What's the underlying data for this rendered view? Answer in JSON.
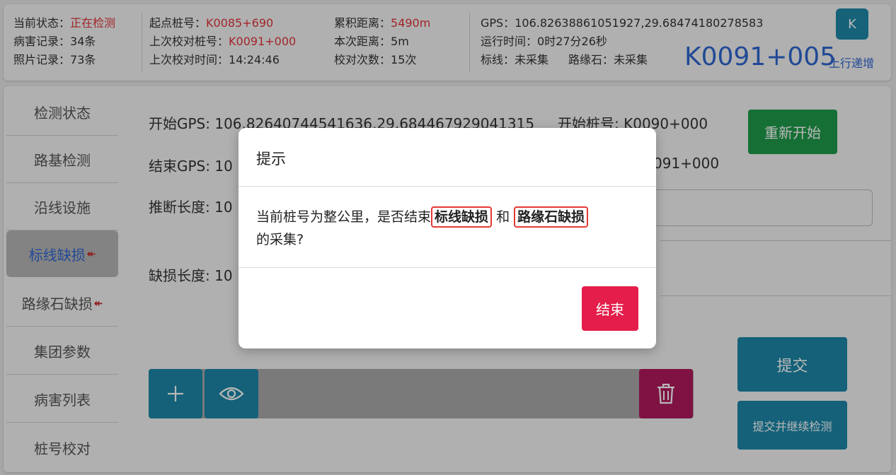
{
  "header": {
    "status_label": "当前状态：",
    "status_value": "正在检测",
    "disease_label": "病害记录：",
    "disease_value": "34条",
    "photo_label": "照片记录：",
    "photo_value": "73条",
    "start_km_label": "起点桩号：",
    "start_km_value": "K0085+690",
    "last_check_km_label": "上次校对桩号：",
    "last_check_km_value": "K0091+000",
    "last_check_time_label": "上次校对时间：",
    "last_check_time_value": "14:24:46",
    "total_dist_label": "累积距离：",
    "total_dist_value": "5490m",
    "this_dist_label": "本次距离：",
    "this_dist_value": "5m",
    "check_count_label": "校对次数：",
    "check_count_value": "15次",
    "gps_label": "GPS：",
    "gps_value": "106.82638861051927,29.68474180278583",
    "runtime_label": "运行时间：",
    "runtime_value": "0时27分26秒",
    "marking_label": "标线：",
    "marking_value": "未采集",
    "curb_label": "路缘石：",
    "curb_value": "未采集",
    "current_km": "K0091+005",
    "direction": "上行递增",
    "k_button": "K"
  },
  "sidebar": {
    "items": [
      {
        "label": "检测状态"
      },
      {
        "label": "路基检测"
      },
      {
        "label": "沿线设施"
      },
      {
        "label": "标线缺损"
      },
      {
        "label": "路缘石缺损"
      },
      {
        "label": "集团参数"
      },
      {
        "label": "病害列表"
      },
      {
        "label": "桩号校对"
      }
    ]
  },
  "content": {
    "start_gps_label": "开始GPS:",
    "start_gps_value": "106.82640744541636,29.684467929041315",
    "start_km_label": "开始桩号:",
    "start_km_value": "K0090+000",
    "end_gps_label": "结束GPS:",
    "end_gps_value_visible": "10",
    "end_km_value_visible": "091+000",
    "inferred_len_label": "推断长度:",
    "inferred_len_value_visible": "10",
    "defect_len_label": "缺损长度:",
    "defect_len_value_visible": "10",
    "restart_button": "重新开始",
    "submit_button": "提交",
    "submit_continue_button": "提交并继续检测"
  },
  "dialog": {
    "title": "提示",
    "msg_part1": "当前桩号为整公里，是否结束",
    "highlight1": "标线缺损",
    "msg_part2": "和",
    "highlight2": "路缘石缺损",
    "msg_part3": "的采集?",
    "end_button": "结束"
  },
  "colors": {
    "accent_blue": "#2f66d0",
    "alert_red": "#e0343a",
    "teal_button": "#1d87a8",
    "green_button": "#1f9a4a",
    "delete_button": "#b01a5e",
    "end_button": "#e41d4a"
  }
}
